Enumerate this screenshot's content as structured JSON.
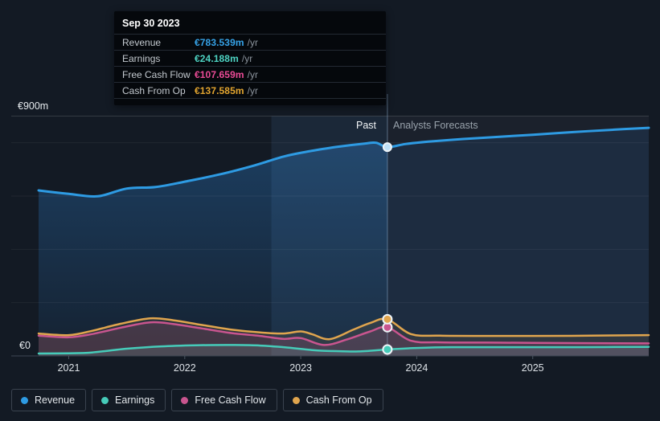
{
  "tooltip": {
    "date": "Sep 30 2023",
    "rows": [
      {
        "label": "Revenue",
        "value": "€783.539m",
        "suffix": "/yr",
        "color": "#36a3e8"
      },
      {
        "label": "Earnings",
        "value": "€24.188m",
        "suffix": "/yr",
        "color": "#4ed4c3"
      },
      {
        "label": "Free Cash Flow",
        "value": "€107.659m",
        "suffix": "/yr",
        "color": "#ea4b96"
      },
      {
        "label": "Cash From Op",
        "value": "€137.585m",
        "suffix": "/yr",
        "color": "#e3a52f"
      }
    ]
  },
  "axis": {
    "y_top_label": "€900m",
    "y_zero_label": "€0",
    "x_ticks": [
      "2021",
      "2022",
      "2023",
      "2024",
      "2025"
    ]
  },
  "annotations": {
    "past": "Past",
    "forecast": "Analysts Forecasts"
  },
  "legend": [
    {
      "label": "Revenue",
      "color": "#2e9be3"
    },
    {
      "label": "Earnings",
      "color": "#46cbb9"
    },
    {
      "label": "Free Cash Flow",
      "color": "#c9558f"
    },
    {
      "label": "Cash From Op",
      "color": "#e0a54e"
    }
  ],
  "chart_data": {
    "type": "area",
    "title": "",
    "xlabel": "",
    "ylabel": "€m",
    "x_range": [
      2020.74,
      2026.0
    ],
    "ylim": [
      0,
      900
    ],
    "y_gridlines": [
      200,
      400,
      600,
      800
    ],
    "x_tick_years": [
      2021,
      2022,
      2023,
      2024,
      2025
    ],
    "divider_x": 2023.747,
    "past_band": [
      2022.747,
      2023.747
    ],
    "units": "EUR millions per year",
    "series": [
      {
        "name": "Revenue",
        "color": "#2e9be3",
        "marker_value": 783.539,
        "points": [
          [
            2020.74,
            621
          ],
          [
            2021.0,
            608
          ],
          [
            2021.25,
            599
          ],
          [
            2021.5,
            628
          ],
          [
            2021.75,
            634
          ],
          [
            2022.0,
            654
          ],
          [
            2022.3,
            681
          ],
          [
            2022.6,
            715
          ],
          [
            2022.85,
            748
          ],
          [
            2023.05,
            766
          ],
          [
            2023.3,
            784
          ],
          [
            2023.55,
            797
          ],
          [
            2023.65,
            800
          ],
          [
            2023.747,
            783.539
          ],
          [
            2023.9,
            795
          ],
          [
            2024.1,
            804
          ],
          [
            2024.4,
            814
          ],
          [
            2024.7,
            822
          ],
          [
            2025.0,
            830
          ],
          [
            2025.35,
            840
          ],
          [
            2025.7,
            849
          ],
          [
            2026.0,
            856
          ]
        ]
      },
      {
        "name": "Earnings",
        "color": "#46cbb9",
        "marker_value": 24.188,
        "points": [
          [
            2020.74,
            9
          ],
          [
            2021.0,
            10
          ],
          [
            2021.2,
            13
          ],
          [
            2021.5,
            27
          ],
          [
            2021.8,
            36
          ],
          [
            2022.1,
            40
          ],
          [
            2022.4,
            41
          ],
          [
            2022.65,
            39
          ],
          [
            2022.9,
            31
          ],
          [
            2023.1,
            22
          ],
          [
            2023.3,
            18
          ],
          [
            2023.5,
            17
          ],
          [
            2023.747,
            24.188
          ],
          [
            2024.0,
            30
          ],
          [
            2024.3,
            33
          ],
          [
            2024.8,
            33
          ],
          [
            2025.4,
            33
          ],
          [
            2026.0,
            34
          ]
        ]
      },
      {
        "name": "Free Cash Flow",
        "color": "#c9558f",
        "marker_value": 107.659,
        "points": [
          [
            2020.74,
            76
          ],
          [
            2021.0,
            70
          ],
          [
            2021.2,
            82
          ],
          [
            2021.45,
            106
          ],
          [
            2021.7,
            126
          ],
          [
            2021.9,
            120
          ],
          [
            2022.15,
            103
          ],
          [
            2022.4,
            86
          ],
          [
            2022.65,
            75
          ],
          [
            2022.85,
            64
          ],
          [
            2023.0,
            67
          ],
          [
            2023.2,
            41
          ],
          [
            2023.4,
            62
          ],
          [
            2023.6,
            92
          ],
          [
            2023.747,
            107.659
          ],
          [
            2023.95,
            57
          ],
          [
            2024.2,
            51
          ],
          [
            2024.6,
            50
          ],
          [
            2025.0,
            49
          ],
          [
            2025.5,
            48
          ],
          [
            2026.0,
            47
          ]
        ]
      },
      {
        "name": "Cash From Op",
        "color": "#e0a54e",
        "marker_value": 137.585,
        "points": [
          [
            2020.74,
            84
          ],
          [
            2021.0,
            78
          ],
          [
            2021.2,
            94
          ],
          [
            2021.45,
            121
          ],
          [
            2021.7,
            141
          ],
          [
            2021.9,
            134
          ],
          [
            2022.15,
            116
          ],
          [
            2022.4,
            99
          ],
          [
            2022.65,
            88
          ],
          [
            2022.85,
            84
          ],
          [
            2023.0,
            92
          ],
          [
            2023.1,
            81
          ],
          [
            2023.25,
            63
          ],
          [
            2023.45,
            98
          ],
          [
            2023.6,
            124
          ],
          [
            2023.747,
            137.585
          ],
          [
            2023.95,
            82
          ],
          [
            2024.2,
            76
          ],
          [
            2024.6,
            75
          ],
          [
            2025.0,
            75
          ],
          [
            2025.5,
            76
          ],
          [
            2026.0,
            78
          ]
        ]
      }
    ]
  }
}
